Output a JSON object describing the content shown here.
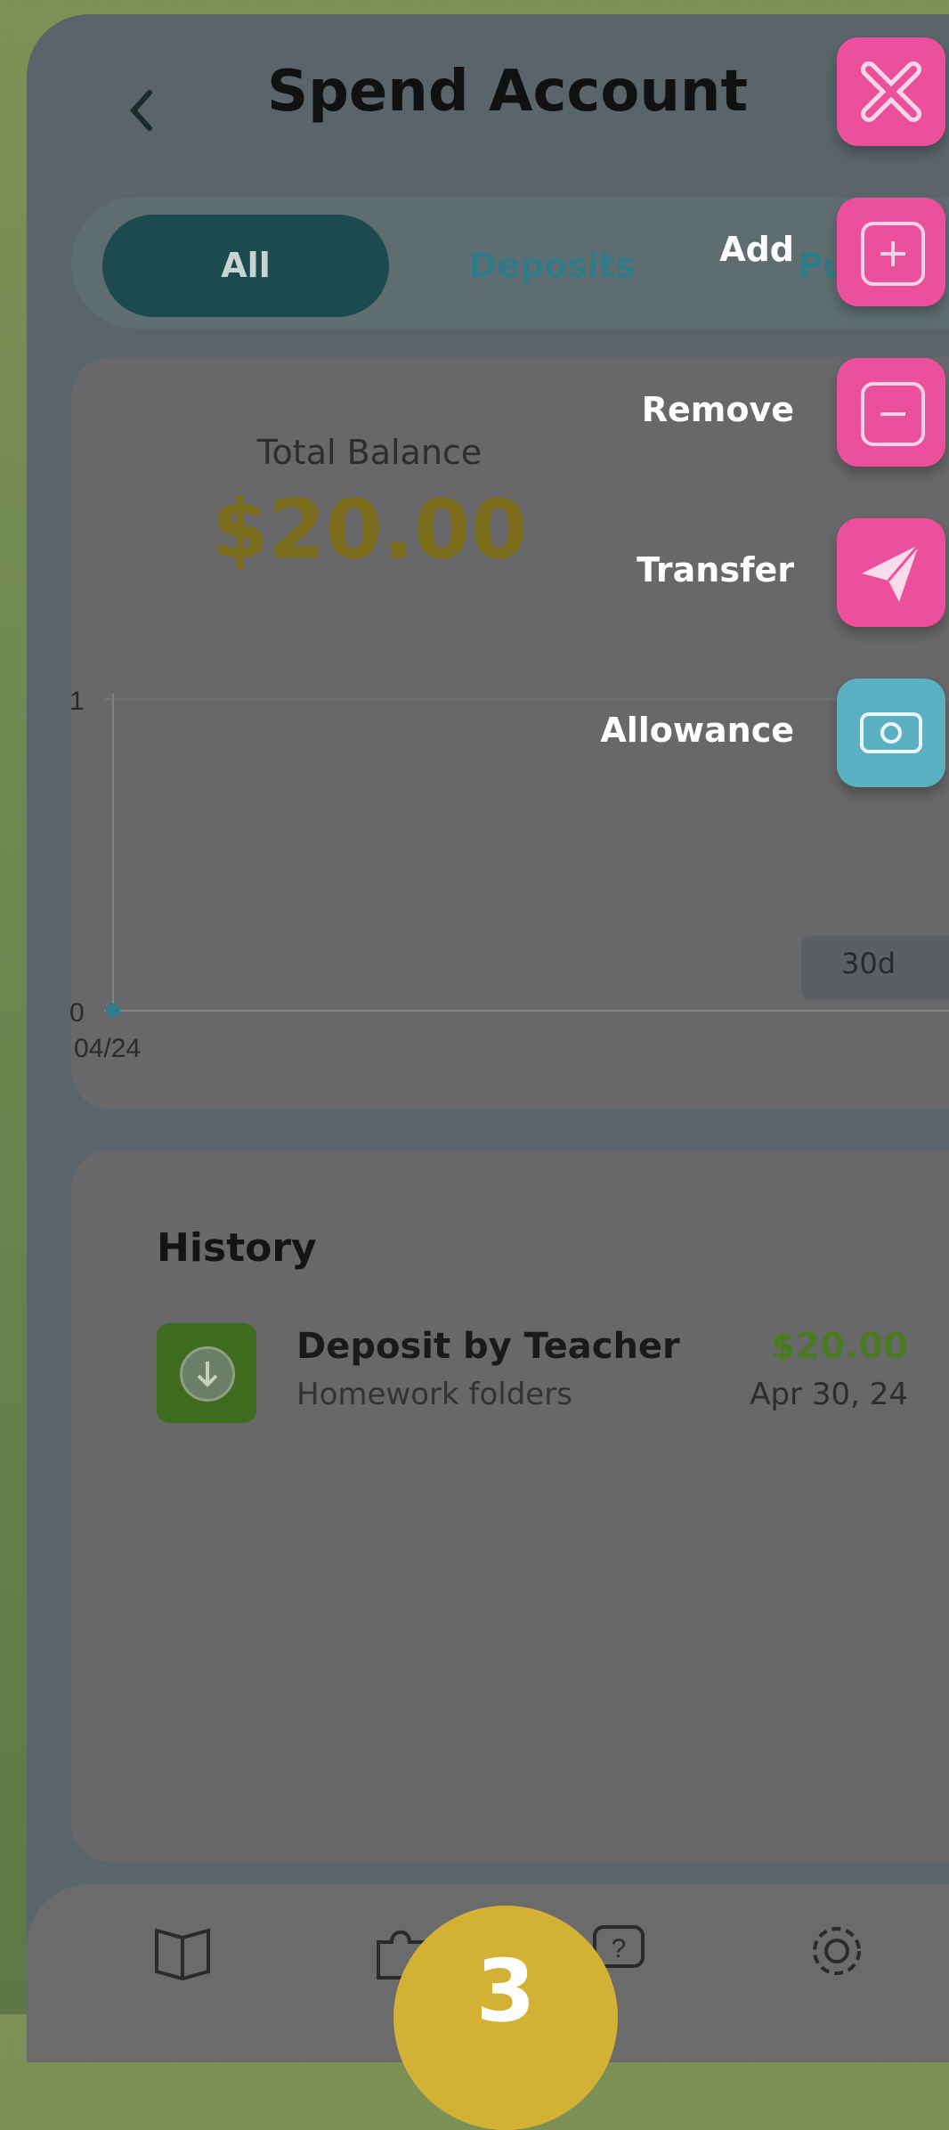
{
  "header": {
    "back_icon": "chevron-left-icon",
    "title": "Spend Account"
  },
  "tabs": [
    {
      "label": "All"
    },
    {
      "label": "Deposits"
    },
    {
      "label": "Puzzle"
    }
  ],
  "balance": {
    "label": "Total Balance",
    "amount": "$20.00",
    "range": "30d"
  },
  "chart_data": {
    "type": "line",
    "x": [
      "04/24"
    ],
    "series": [
      {
        "values": [
          0
        ]
      }
    ],
    "yticks": [
      "1",
      "0"
    ],
    "xticks": [
      "04/24"
    ],
    "ylim": [
      0,
      1
    ]
  },
  "history": {
    "title": "History",
    "items": [
      {
        "name": "Deposit by Teacher",
        "description": "Homework folders",
        "amount": "$20.00",
        "date": "Apr 30, 24",
        "icon": "download-icon"
      }
    ]
  },
  "fab_menu": {
    "close_icon": "close-icon",
    "items": [
      {
        "label": "Add",
        "icon": "plus-icon"
      },
      {
        "label": "Remove",
        "icon": "minus-icon"
      },
      {
        "label": "Transfer",
        "icon": "send-icon"
      },
      {
        "label": "Allowance",
        "icon": "cash-icon"
      }
    ]
  },
  "nav": {
    "items": [
      "book-icon",
      "puzzle-icon",
      "help-icon",
      "gear-icon"
    ],
    "badge": "3"
  },
  "colors": {
    "accent_pink": "#ec4f9c",
    "accent_blue": "#5bb0c1",
    "badge_yellow": "#d2b135",
    "amount_green": "#4a7a22"
  }
}
